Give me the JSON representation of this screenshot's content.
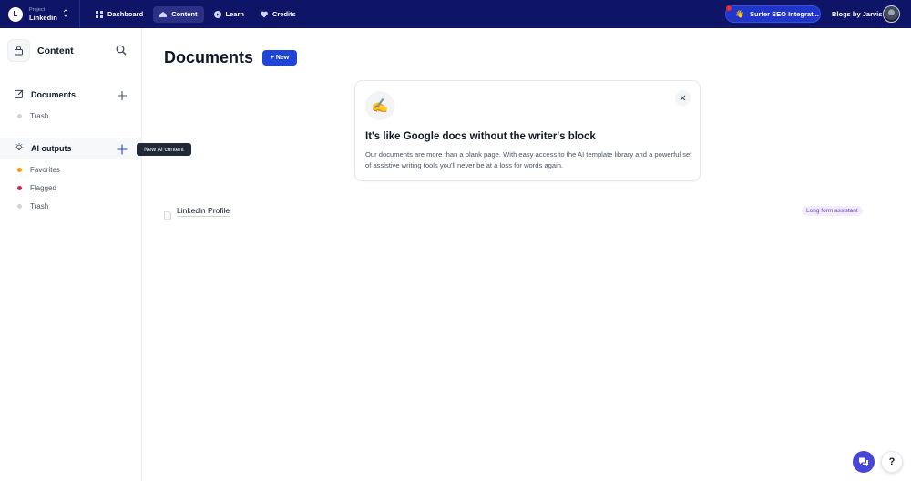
{
  "topbar": {
    "project_label": "Project",
    "project_name": "Linkedin",
    "project_initial": "L",
    "nav": [
      {
        "label": "Dashboard",
        "icon": "grid-icon"
      },
      {
        "label": "Content",
        "icon": "content-icon",
        "active": true
      },
      {
        "label": "Learn",
        "icon": "play-circle-icon"
      },
      {
        "label": "Credits",
        "icon": "heart-icon"
      }
    ],
    "surfer_label": "Surfer SEO Integrat...",
    "surfer_emoji": "👋",
    "workspace_name": "Blogs by Jarvis"
  },
  "sidebar": {
    "title": "Content",
    "documents_label": "Documents",
    "documents_trash": "Trash",
    "ai_outputs_label": "AI outputs",
    "ai_items": [
      {
        "label": "Favorites",
        "color": "#f59e0b"
      },
      {
        "label": "Flagged",
        "color": "#e11d48"
      },
      {
        "label": "Trash",
        "color": "#d1d5db"
      }
    ],
    "tooltip": "New AI content"
  },
  "main": {
    "title": "Documents",
    "new_button": "+ New",
    "card": {
      "emoji": "✍️",
      "title": "It's like Google docs without the writer's block",
      "body": "Our documents are more than a blank page. With easy access to the AI template library and a powerful set of assistive writing tools you'll never be at a loss for words again."
    },
    "documents": [
      {
        "name": "Linkedin Profile",
        "badge": "Long form assistant"
      }
    ]
  },
  "floating": {
    "help_label": "?"
  },
  "colors": {
    "topbar_bg": "#0e1466",
    "primary": "#1f44d8",
    "badge_text": "#6d3fd6"
  }
}
